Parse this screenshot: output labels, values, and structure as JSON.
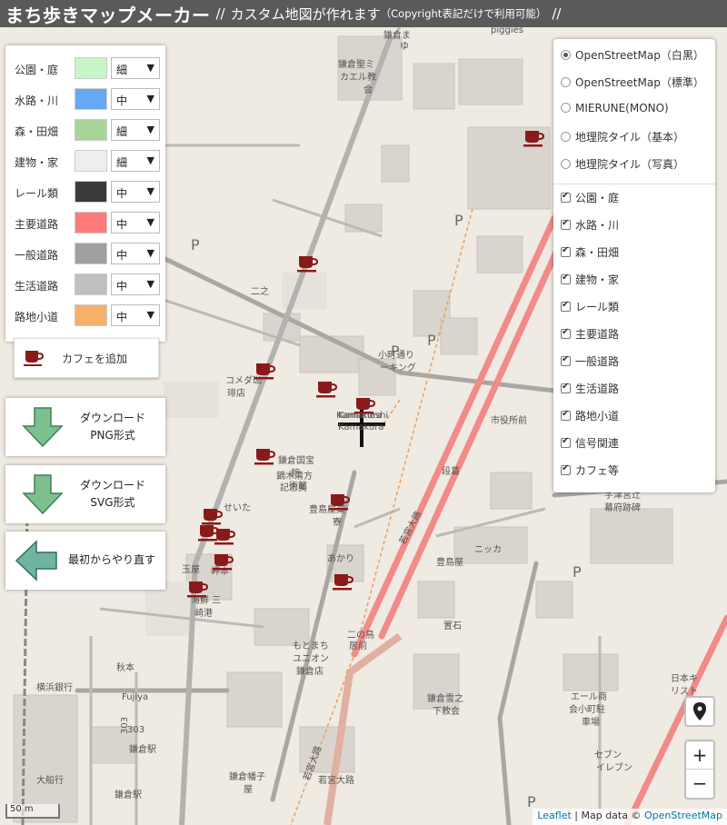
{
  "header": {
    "title": "まち歩きマップメーカー",
    "sep1": "//",
    "subtitle": "カスタム地図が作れます",
    "note": "（Copyright表記だけで利用可能）",
    "sep2": "//"
  },
  "style_panel": {
    "rows": [
      {
        "label": "公園・庭",
        "color": "#c8f5c8",
        "value": "細"
      },
      {
        "label": "水路・川",
        "color": "#66a8f5",
        "value": "中"
      },
      {
        "label": "森・田畑",
        "color": "#a8d497",
        "value": "細"
      },
      {
        "label": "建物・家",
        "color": "#eeeeee",
        "value": "細"
      },
      {
        "label": "レール類",
        "color": "#3a3a3a",
        "value": "中"
      },
      {
        "label": "主要道路",
        "color": "#ff7a7a",
        "value": "中"
      },
      {
        "label": "一般道路",
        "color": "#a0a0a0",
        "value": "中"
      },
      {
        "label": "生活道路",
        "color": "#c0c0c0",
        "value": "中"
      },
      {
        "label": "路地小道",
        "color": "#f5b06a",
        "value": "中"
      }
    ],
    "dropdown_icon": "triangle-down-icon"
  },
  "cafe_button": {
    "label": "カフェを追加",
    "icon": "coffee-cup-icon"
  },
  "download_png": {
    "line1": "ダウンロード",
    "line2": "PNG形式",
    "icon": "arrow-down-icon"
  },
  "download_svg": {
    "line1": "ダウンロード",
    "line2": "SVG形式",
    "icon": "arrow-down-icon"
  },
  "restart": {
    "label": "最初からやり直す",
    "icon": "arrow-left-icon"
  },
  "layers": {
    "base": [
      {
        "label": "OpenStreetMap（白黒）",
        "selected": true
      },
      {
        "label": "OpenStreetMap（標準）",
        "selected": false
      },
      {
        "label": "MIERUNE(MONO)",
        "selected": false
      },
      {
        "label": "地理院タイル（基本）",
        "selected": false
      },
      {
        "label": "地理院タイル（写真）",
        "selected": false
      }
    ],
    "overlays": [
      {
        "label": "公園・庭",
        "checked": true
      },
      {
        "label": "水路・川",
        "checked": true
      },
      {
        "label": "森・田畑",
        "checked": true
      },
      {
        "label": "建物・家",
        "checked": true
      },
      {
        "label": "レール類",
        "checked": true
      },
      {
        "label": "主要道路",
        "checked": true
      },
      {
        "label": "一般道路",
        "checked": true
      },
      {
        "label": "生活道路",
        "checked": true
      },
      {
        "label": "路地小道",
        "checked": true
      },
      {
        "label": "信号関連",
        "checked": true
      },
      {
        "label": "カフェ等",
        "checked": true
      }
    ]
  },
  "map": {
    "labels": [
      "鎌倉聖ミ",
      "カエル教",
      "会",
      "piggies",
      "鎌倉ま",
      "ゆ",
      "二之",
      "コメダ珈",
      "琲店",
      "鎌倉国宝",
      "館",
      "鏑木清方",
      "記念美",
      "術館",
      "せいた",
      "豊島屋菓",
      "寮",
      "あかり",
      "小町通り",
      "ーキング",
      "Kamakura",
      "Kamakura",
      "宇津宮辻",
      "幕府跡碑",
      "豊島屋",
      "置石",
      "二の鳥",
      "居前",
      "もとまち",
      "ユニオン",
      "鎌倉店",
      "秋本",
      "横浜銀行",
      "Fujiya",
      "鎌倉駅",
      "鎌倉幡子",
      "屋",
      "鎌倉駅",
      "大船行",
      "海鮮 三",
      "崎港",
      "岬本",
      "玉屋",
      "鎌倉雪之",
      "下教会",
      "エール商",
      "会小町駐",
      "車場",
      "セブン",
      "イレブン",
      "日本キ",
      "リスト",
      "若宮大路",
      "段葛",
      "市役所前",
      "ニッカ",
      "P",
      "P",
      "P",
      "P",
      "P",
      "303",
      "Kamaneshi"
    ],
    "marker_icon": "map-pin-icon",
    "zoom_in": "+",
    "zoom_out": "−",
    "scale": "50 m",
    "attribution": {
      "leaflet": "Leaflet",
      "sep": "| Map data ©",
      "osm": "OpenStreetMap"
    }
  },
  "colors": {
    "main_road": "#f28a8a",
    "cafe_icon": "#8a1a1a",
    "header_bg": "#5a5a5a",
    "arrow_green": "#7dbf8f",
    "arrow_teal": "#6fb3a0"
  }
}
